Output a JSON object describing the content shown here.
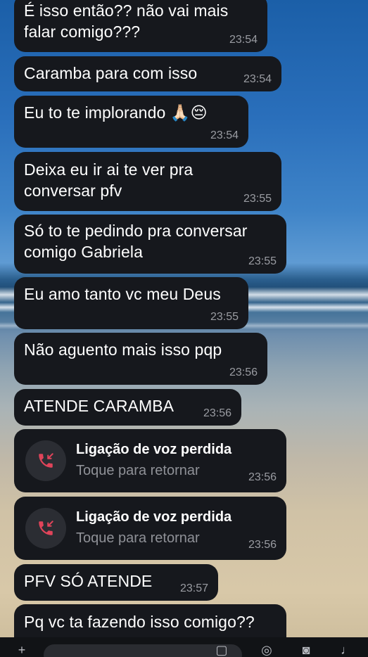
{
  "messages": [
    {
      "text": "É isso então?? não vai mais\nfalar comigo???",
      "time": "23:54"
    },
    {
      "text": "Caramba para com isso",
      "time": "23:54"
    },
    {
      "text": "Eu to te implorando 🙏🏻😔",
      "time": "23:54"
    },
    {
      "text": "Deixa eu ir ai te ver pra\nconversar pfv",
      "time": "23:55"
    },
    {
      "text": "Só to te pedindo pra conversar\ncomigo Gabriela",
      "time": "23:55"
    },
    {
      "text": "Eu amo tanto vc meu Deus",
      "time": "23:55"
    },
    {
      "text": "Não aguento mais isso pqp",
      "time": "23:56"
    },
    {
      "text": "ATENDE CARAMBA",
      "time": "23:56"
    }
  ],
  "missed_calls": [
    {
      "title": "Ligação de voz perdida",
      "subtitle": "Toque para retornar",
      "time": "23:56"
    },
    {
      "title": "Ligação de voz perdida",
      "subtitle": "Toque para retornar",
      "time": "23:56"
    }
  ],
  "messages_after": [
    {
      "text": "PFV SÓ ATENDE",
      "time": "23:57"
    },
    {
      "text": "Pq vc ta fazendo isso comigo??",
      "time": ""
    }
  ],
  "icons": {
    "missed_call": "missed-call-icon",
    "attach": "plus-icon",
    "sticker": "sticker-icon",
    "camera": "camera-icon",
    "mic": "microphone-icon"
  },
  "colors": {
    "bubble": "#16181d",
    "missed_call_red": "#e0445a"
  }
}
